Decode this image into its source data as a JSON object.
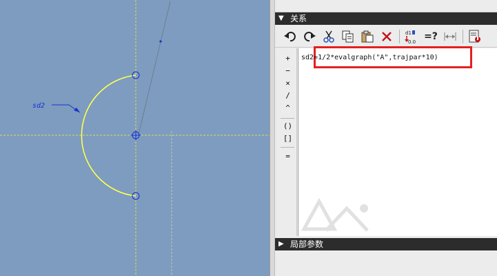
{
  "canvas": {
    "dimension_label": "sd2",
    "colors": {
      "background": "#7d9cc0",
      "arc": "#ffff4f",
      "centerline": "#e6d84a",
      "dimension": "#1a2fd0",
      "leader": "#707d88"
    }
  },
  "panel": {
    "relations_header": "关系",
    "local_params_header": "局部参数",
    "toolbar": {
      "undo_icon": "undo-icon",
      "redo_icon": "redo-icon",
      "cut_icon": "scissors-icon",
      "copy_icon": "copy-icon",
      "paste_icon": "paste-icon",
      "delete_icon": "delete-icon",
      "eval_label": "=?"
    },
    "operators": [
      "+",
      "−",
      "×",
      "/",
      "^",
      "()",
      "[]",
      "="
    ],
    "relation_text": "sd2=1/2*evalgraph(\"A\",trajpar*10)",
    "highlight_color": "#e3201f"
  }
}
